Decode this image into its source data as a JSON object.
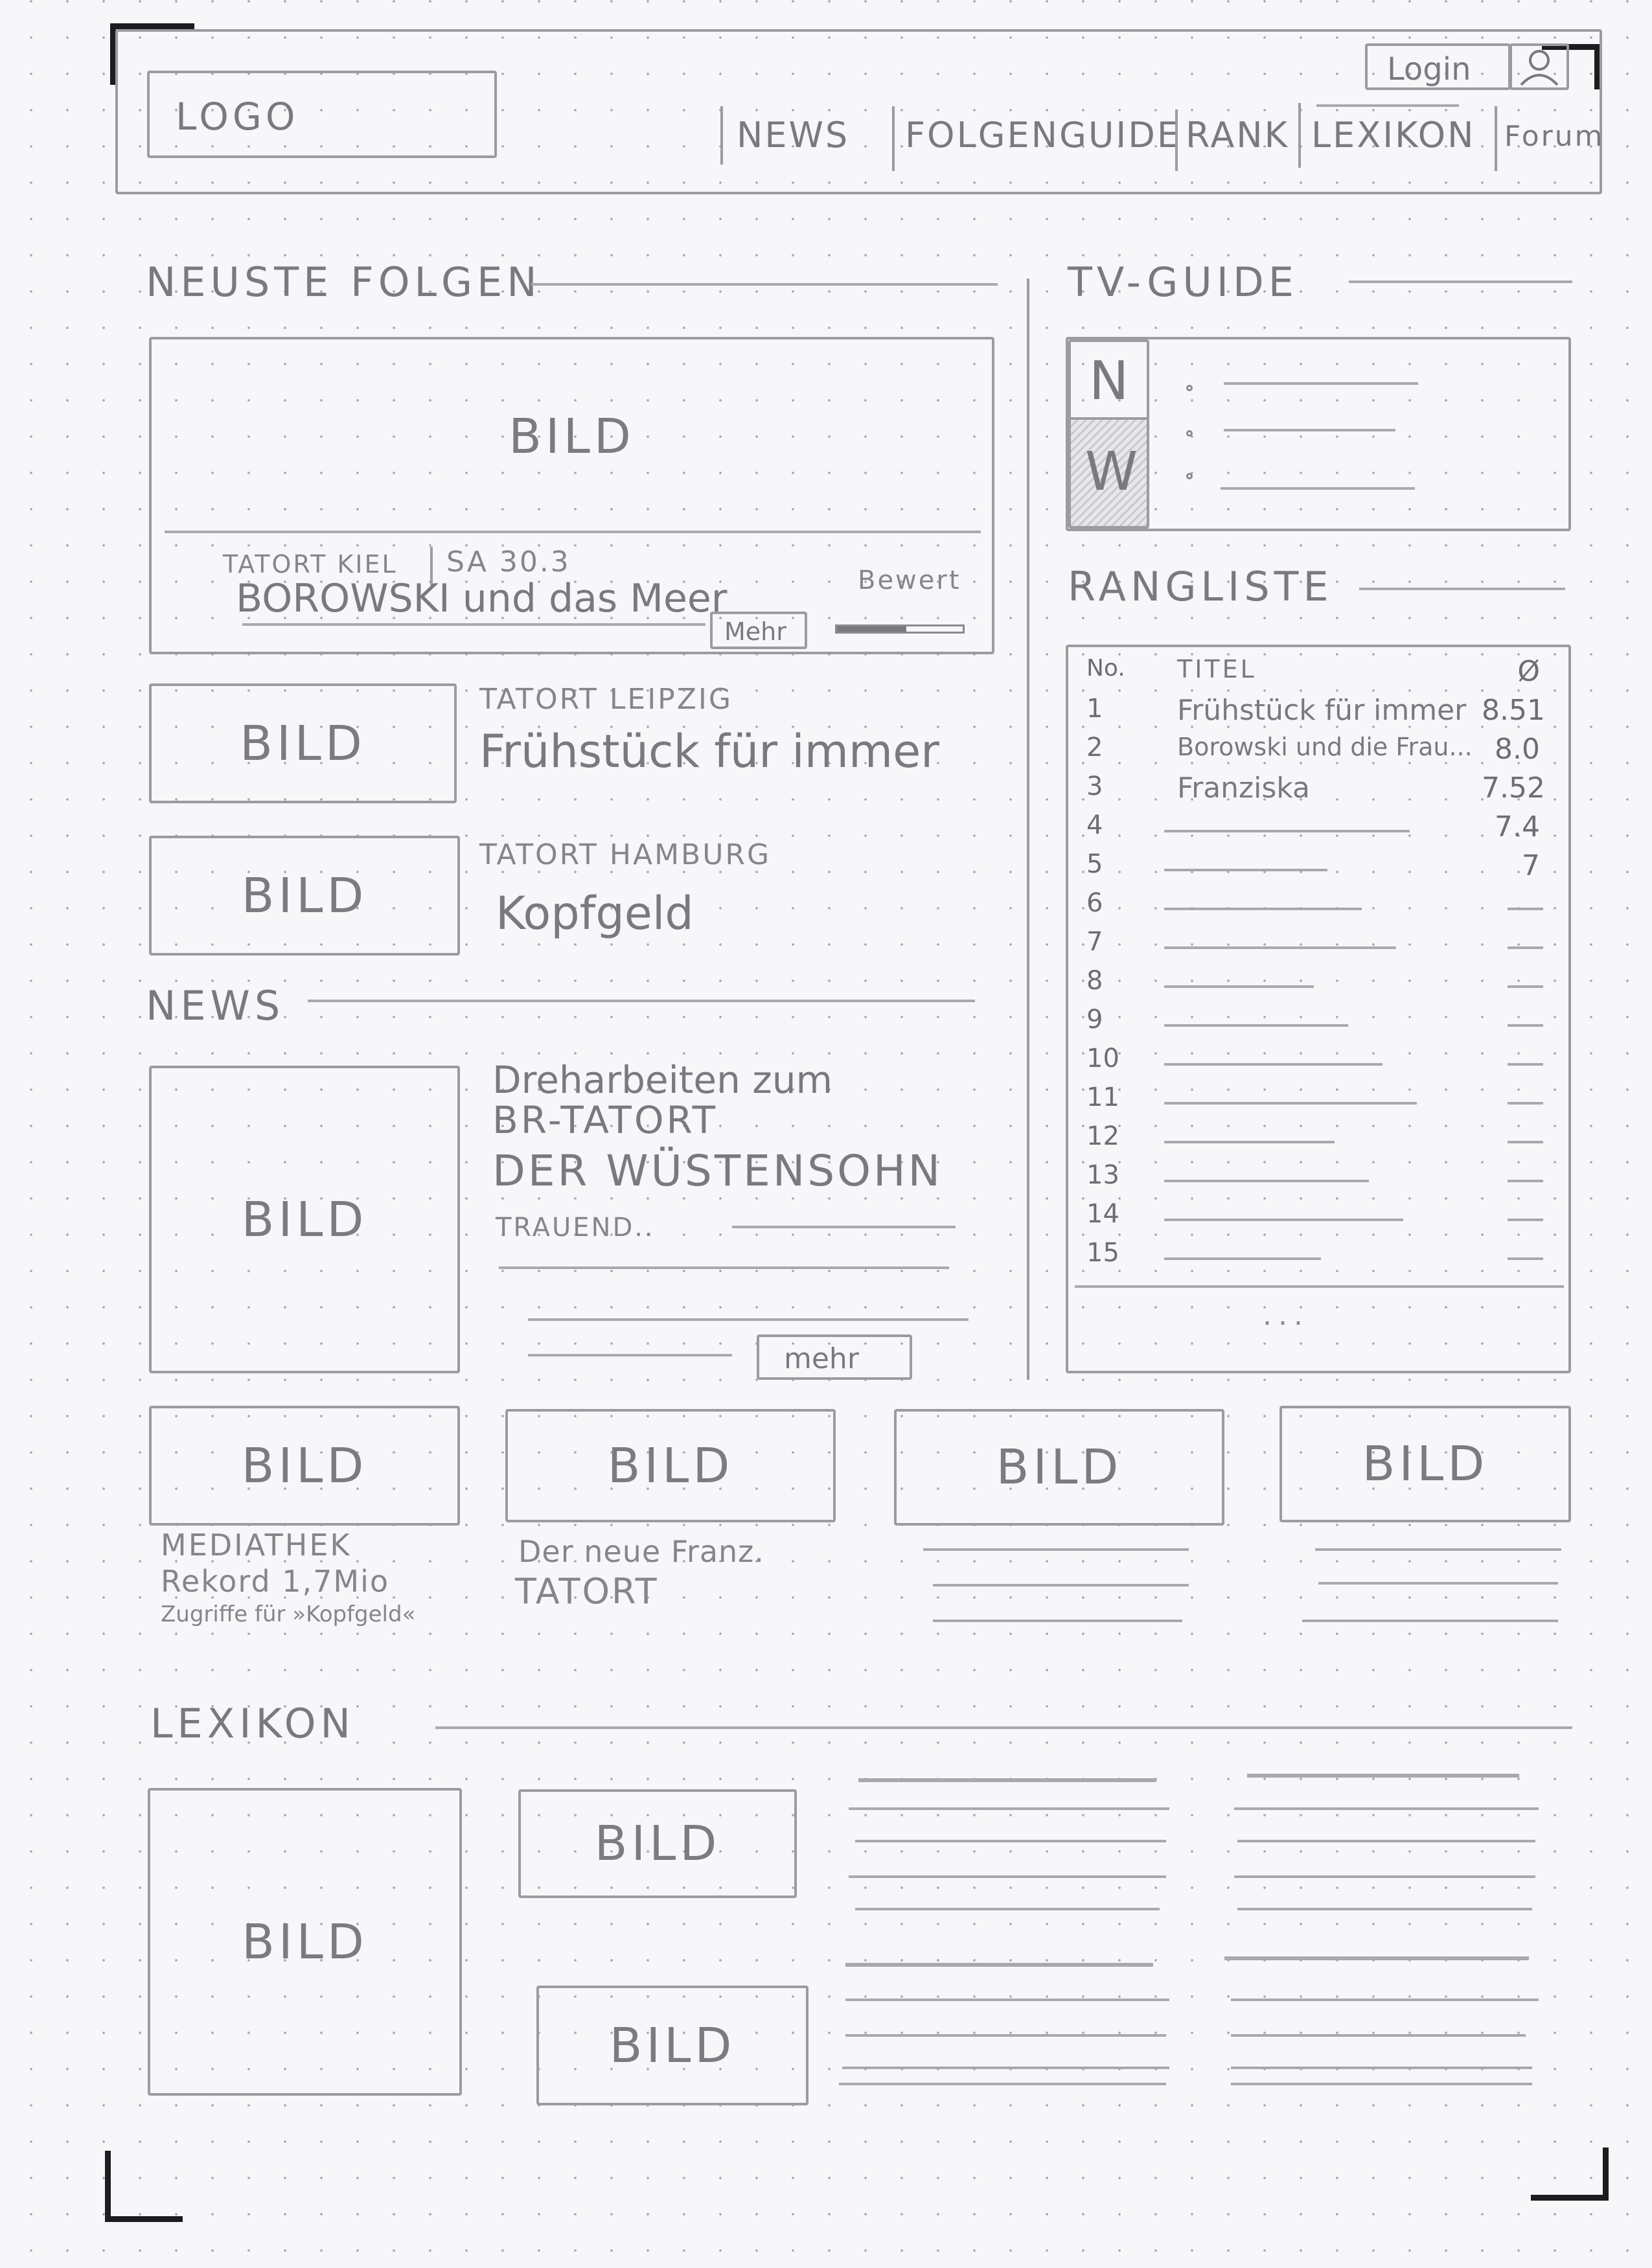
{
  "header": {
    "logo": "LOGO",
    "login": "Login",
    "user_icon": "user-icon",
    "nav": [
      "NEWS",
      "FOLGENGUIDE",
      "RANK",
      "LEXIKON",
      "Forum"
    ]
  },
  "neuste_folgen": {
    "heading": "NEUSTE FOLGEN",
    "featured": {
      "image": "BILD",
      "location": "TATORT KIEL",
      "date": "SA 30.3",
      "title": "BOROWSKI und das Meer",
      "rating_label": "Bewert",
      "more": "Mehr"
    },
    "items": [
      {
        "image": "BILD",
        "location": "TATORT LEIPZIG",
        "title": "Frühstück für immer"
      },
      {
        "image": "BILD",
        "location": "TATORT HAMBURG",
        "title": "Kopfgeld"
      }
    ]
  },
  "news": {
    "heading": "NEWS",
    "main": {
      "image": "BILD",
      "line1": "Dreharbeiten zum",
      "line2": "BR-TATORT",
      "line3": "DER WÜSTENSOHN",
      "teaser": "TRAUEND..",
      "more": "mehr"
    },
    "tiles": [
      {
        "image": "BILD",
        "lines": [
          "MEDIATHEK",
          "Rekord 1,7Mio",
          "Zugriffe für »Kopfgeld«"
        ]
      },
      {
        "image": "BILD",
        "lines": [
          "Der neue Franz.",
          "TATORT"
        ]
      },
      {
        "image": "BILD",
        "lines": []
      },
      {
        "image": "BILD",
        "lines": []
      }
    ]
  },
  "tv_guide": {
    "heading": "TV-GUIDE",
    "letters": [
      "N",
      "W"
    ]
  },
  "rangliste": {
    "heading": "RANGLISTE",
    "col_no": "No.",
    "col_title": "TITEL",
    "col_score": "Ø",
    "rows": [
      {
        "no": "1",
        "title": "Frühstück für immer",
        "score": "8.51"
      },
      {
        "no": "2",
        "title": "Borowski und die Frau...",
        "score": "8.0"
      },
      {
        "no": "3",
        "title": "Franziska",
        "score": "7.52"
      },
      {
        "no": "4",
        "title": "",
        "score": "7.4"
      },
      {
        "no": "5",
        "title": "",
        "score": "7"
      },
      {
        "no": "6",
        "title": "",
        "score": ""
      },
      {
        "no": "7",
        "title": "",
        "score": ""
      },
      {
        "no": "8",
        "title": "",
        "score": ""
      },
      {
        "no": "9",
        "title": "",
        "score": ""
      },
      {
        "no": "10",
        "title": "",
        "score": ""
      },
      {
        "no": "11",
        "title": "",
        "score": ""
      },
      {
        "no": "12",
        "title": "",
        "score": ""
      },
      {
        "no": "13",
        "title": "",
        "score": ""
      },
      {
        "no": "14",
        "title": "",
        "score": ""
      },
      {
        "no": "15",
        "title": "",
        "score": ""
      }
    ],
    "more": "..."
  },
  "lexikon": {
    "heading": "LEXIKON",
    "images": [
      "BILD",
      "BILD",
      "BILD"
    ]
  }
}
